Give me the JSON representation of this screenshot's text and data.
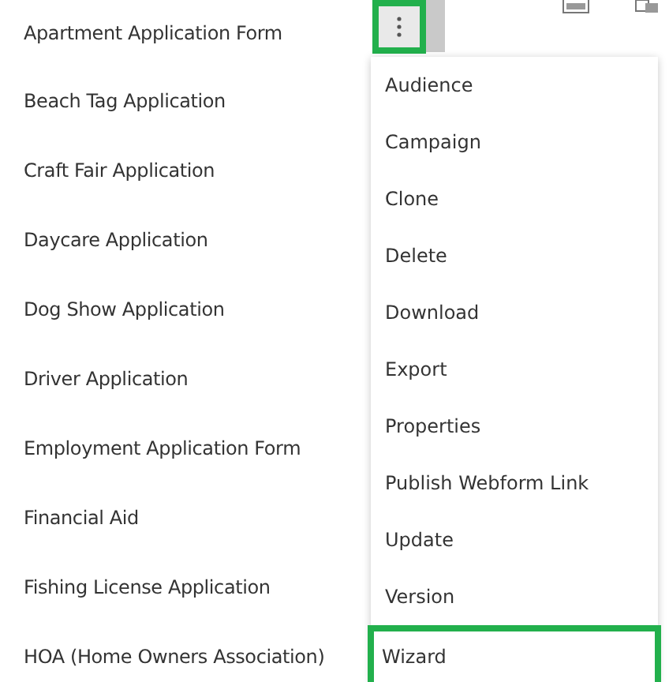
{
  "forms": [
    {
      "name": "Apartment Application Form"
    },
    {
      "name": "Beach Tag Application"
    },
    {
      "name": "Craft Fair Application"
    },
    {
      "name": "Daycare Application"
    },
    {
      "name": "Dog Show Application"
    },
    {
      "name": "Driver Application"
    },
    {
      "name": "Employment Application Form"
    },
    {
      "name": "Financial Aid"
    },
    {
      "name": "Fishing License Application"
    },
    {
      "name": "HOA (Home Owners Association)"
    }
  ],
  "menu": [
    {
      "label": "Audience",
      "selected": false
    },
    {
      "label": "Campaign",
      "selected": false
    },
    {
      "label": "Clone",
      "selected": false
    },
    {
      "label": "Delete",
      "selected": false
    },
    {
      "label": "Download",
      "selected": false
    },
    {
      "label": "Export",
      "selected": false
    },
    {
      "label": "Properties",
      "selected": false
    },
    {
      "label": "Publish Webform Link",
      "selected": false
    },
    {
      "label": "Update",
      "selected": false
    },
    {
      "label": "Version",
      "selected": false
    },
    {
      "label": "Wizard",
      "selected": true
    }
  ]
}
